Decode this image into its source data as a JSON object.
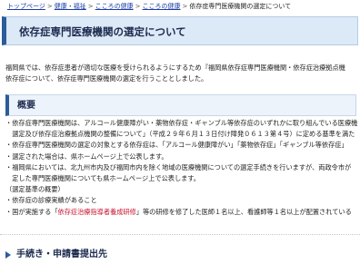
{
  "breadcrumb": {
    "items": [
      "トップページ",
      "健康・福祉",
      "こころの健康",
      "こころの健康"
    ],
    "separator": ">",
    "current": "依存症専門医療機関の選定について"
  },
  "page_title": "依存症専門医療機関の選定について",
  "intro": {
    "line1": "福岡県では、依存症患者が適切な医療を受けられるようにするため『福岡県依存症専門医療機関・依存症治療拠点機",
    "line2": "依存症について、依存症専門医療機関の選定を行うこととしました。"
  },
  "overview": {
    "heading": "概要",
    "rows": [
      "・依存症専門医療機関は、アルコール健康障がい・薬物依存症・ギャンブル等依存症のいずれかに取り組んでいる医療機",
      "　選定及び依存症治療拠点機関の整備について」（平成２９年６月１３日付け障発０６１３第４号）に定める基準を満た",
      "・依存症専門医療機関の選定の対象とする依存症は、「アルコール健康障がい」「薬物依存症」「ギャンブル等依存症」",
      "・選定された場合は、県ホームページ上で公表します。",
      "・福岡県においては、北九州市内及び福岡市内を除く地域の医療機関についての選定手続きを行いますが、両政令市が",
      "　定した専門医療機関についても県ホームページ上で公表します。",
      "（選定基準の概要）",
      "・依存症の診療実績があること"
    ],
    "last_row": {
      "pre": "・国が実施する「",
      "highlight": "依存症治療指導者養成研修",
      "post": "」等の研修を修了した医師１名以上、看護師等１名以上が配置されている"
    }
  },
  "section2": {
    "heading": "手続き・申請書提出先"
  },
  "colors": {
    "accent": "#2c5c9a",
    "title_bg": "#dce9f7",
    "link": "#1a3da6",
    "highlight": "#c8102e"
  }
}
